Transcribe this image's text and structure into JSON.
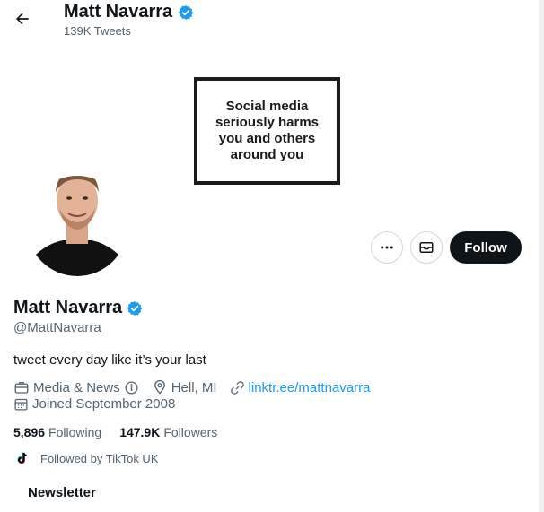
{
  "header": {
    "name": "Matt Navarra",
    "tweet_count": "139K Tweets"
  },
  "banner": {
    "text": "Social media seriously harms you and others around you"
  },
  "actions": {
    "more_icon": "more-horizontal-icon",
    "message_icon": "envelope-icon",
    "follow_label": "Follow"
  },
  "profile": {
    "name": "Matt Navarra",
    "handle": "@MattNavarra",
    "bio": "tweet every day like it’s your last",
    "category": "Media & News",
    "location": "Hell, MI",
    "website": "linktr.ee/mattnavarra",
    "joined": "Joined September 2008",
    "following_count": "5,896",
    "following_label": "Following",
    "followers_count": "147.9K",
    "followers_label": "Followers",
    "followed_by": "Followed by TikTok UK"
  },
  "tabs": {
    "newsletter": "Newsletter"
  },
  "colors": {
    "verified": "#1d9bf0",
    "link": "#1d9bf0",
    "follow_button_bg": "#0f1419",
    "secondary_text": "#536471"
  }
}
